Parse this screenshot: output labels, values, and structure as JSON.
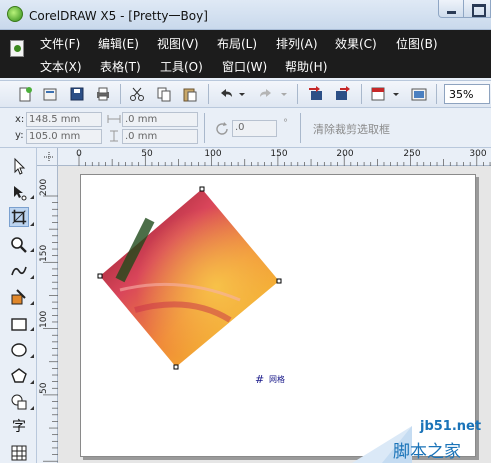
{
  "window": {
    "title": "CorelDRAW X5 - [Pretty一Boy]"
  },
  "menu": {
    "row1": [
      "文件(F)",
      "编辑(E)",
      "视图(V)",
      "布局(L)",
      "排列(A)",
      "效果(C)",
      "位图(B)"
    ],
    "row2": [
      "文本(X)",
      "表格(T)",
      "工具(O)",
      "窗口(W)",
      "帮助(H)"
    ]
  },
  "toolbar": {
    "icons": [
      "new-icon",
      "open-icon",
      "save-icon",
      "print-icon",
      "cut-icon",
      "copy-icon",
      "paste-icon",
      "undo-icon",
      "redo-icon",
      "import-icon",
      "export-icon",
      "publish-pdf-icon",
      "app-launcher-icon"
    ],
    "zoom": "35%"
  },
  "property_bar": {
    "x_label": "x:",
    "x_value": "148.5 mm",
    "y_label": "y:",
    "y_value": "105.0 mm",
    "width_value": ".0 mm",
    "height_value": ".0 mm",
    "angle_value": ".0",
    "angle_unit": "°",
    "clear_crop_label": "清除裁剪选取框"
  },
  "toolbox": {
    "tools": [
      "pick-tool-icon",
      "shape-tool-icon",
      "crop-tool-icon",
      "zoom-tool-icon",
      "freehand-tool-icon",
      "smart-fill-tool-icon",
      "rectangle-tool-icon",
      "ellipse-tool-icon",
      "polygon-tool-icon",
      "basic-shapes-tool-icon",
      "text-tool-icon",
      "table-tool-icon"
    ],
    "active": "crop-tool-icon",
    "text_tool_char": "字"
  },
  "rulers": {
    "horizontal": [
      "0",
      "50",
      "100",
      "150",
      "200",
      "250",
      "300"
    ],
    "vertical": [
      "200",
      "150",
      "100",
      "50"
    ]
  },
  "canvas": {
    "grid_label": "网格"
  },
  "watermark": {
    "line1": "jb51.net",
    "line2": "脚本之家"
  },
  "colors": {
    "menubar_bg": "#1c1c1c",
    "selection_handles": "#000000",
    "watermark": "#1a73b8"
  }
}
